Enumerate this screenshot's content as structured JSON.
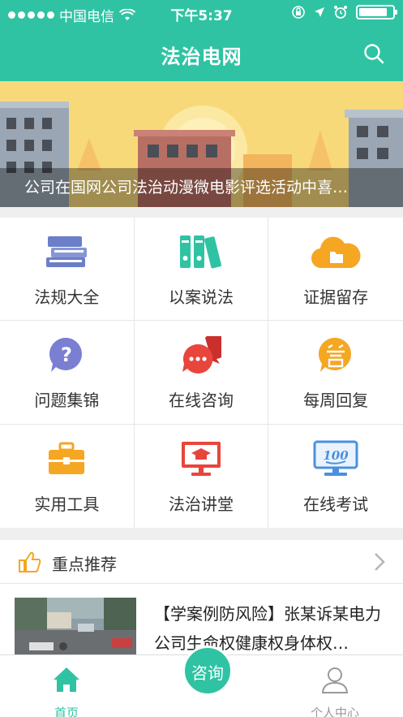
{
  "status": {
    "carrier": "中国电信",
    "time": "下午5:37",
    "battery_level": 0.85
  },
  "header": {
    "title": "法治电网"
  },
  "banner": {
    "caption": "公司在国网公司法治动漫微电影评选活动中喜…"
  },
  "grid": [
    {
      "label": "法规大全",
      "icon": "books-icon",
      "color": "#6b7fc9"
    },
    {
      "label": "以案说法",
      "icon": "binders-icon",
      "color": "#2fc3a3"
    },
    {
      "label": "证据留存",
      "icon": "cloud-folder-icon",
      "color": "#f5a623"
    },
    {
      "label": "问题集锦",
      "icon": "question-bubble-icon",
      "color": "#7b7fd1"
    },
    {
      "label": "在线咨询",
      "icon": "chat-bubble-icon",
      "color": "#e8453c"
    },
    {
      "label": "每周回复",
      "icon": "answer-bubble-icon",
      "color": "#f5a623"
    },
    {
      "label": "实用工具",
      "icon": "toolbox-icon",
      "color": "#f5a623"
    },
    {
      "label": "法治讲堂",
      "icon": "lecture-screen-icon",
      "color": "#e8453c"
    },
    {
      "label": "在线考试",
      "icon": "exam-monitor-icon",
      "color": "#4a90e2"
    }
  ],
  "recommend": {
    "title": "重点推荐",
    "news": [
      {
        "title": "【学案例防风险】张某诉某电力公司生命权健康权身体权…"
      }
    ]
  },
  "tabbar": {
    "home": "首页",
    "consult": "咨询",
    "me": "个人中心"
  }
}
